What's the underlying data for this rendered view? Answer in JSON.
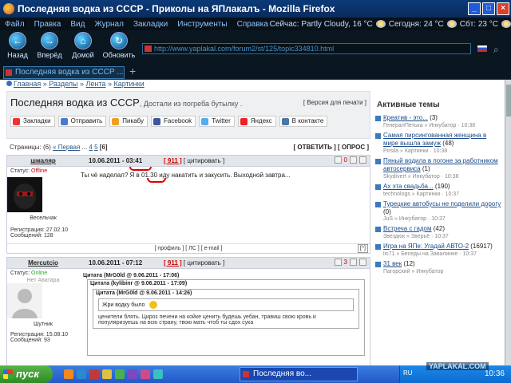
{
  "window": {
    "title": "Последняя водка из СССР - Приколы на ЯПлакалъ - Mozilla Firefox"
  },
  "menu": {
    "items": [
      "Файл",
      "Правка",
      "Вид",
      "Журнал",
      "Закладки",
      "Инструменты",
      "Справка"
    ],
    "weather_now": "Сейчас: Partly Cloudy, 16 °C",
    "weather_today": "Сегодня: 24 °C",
    "weather_sat": "Сбт: 23 °C"
  },
  "nav": {
    "back": "Назад",
    "forward": "Вперёд",
    "home": "Домой",
    "refresh": "Обновить",
    "url": "http://www.yaplakal.com/forum2/st/125/topic334810.html"
  },
  "tab": {
    "label": "Последняя водка из СССР ...",
    "new_tab": "+"
  },
  "breadcrumbs": [
    "Главная",
    "Разделы",
    "Лента",
    "Картинки"
  ],
  "topic": {
    "title": "Последняя водка из СССР",
    "subtitle": ", Достали из погреба бутылку .",
    "print_version": "[ Версия для печати ]"
  },
  "share": [
    {
      "label": "Закладки",
      "color": "#e33"
    },
    {
      "label": "Отправить",
      "color": "#4a7ad0"
    },
    {
      "label": "Пикабу",
      "color": "#f0a020"
    },
    {
      "label": "Facebook",
      "color": "#3b5998"
    },
    {
      "label": "Twitter",
      "color": "#55acee"
    },
    {
      "label": "Яндекс",
      "color": "#e22"
    },
    {
      "label": "В контакте",
      "color": "#4a76a8"
    }
  ],
  "pages": {
    "prefix": "Страницы: (6)",
    "first": "« Первая",
    "dots": "...",
    "p4": "4",
    "p5": "5",
    "current": "[6]",
    "actions": "[ ОТВЕТИТЬ ] [ ОПРОС ]"
  },
  "posts": [
    {
      "author": "шмаляр",
      "date": "10.06.2011 - 03:41",
      "num_label": "[ 911 ]",
      "quote_label": "[ цитировать ]",
      "status_label": "Статус:",
      "status": "Offline",
      "rank": "Весельчак",
      "reg": "Регистрация: 27.02.10",
      "msgs": "Сообщений: 128",
      "rating": "0",
      "text": "Ты чё наделал? Я в 01.30 иду накатить и закусить. Выходной завтра...",
      "footer": "[ профиль ]  [ ЛС ]  [ e-mail ]",
      "up": "[^]"
    },
    {
      "author": "Mercutcio",
      "date": "10.06.2011 - 07:12",
      "num_label": "[ 911 ]",
      "quote_label": "[ цитировать ]",
      "status_label": "Статус:",
      "status": "Online",
      "avatar_text": "Нет Аватара",
      "rank": "Шутник",
      "reg": "Регистрация: 15.08.10",
      "msgs": "Сообщений: 93",
      "rating": "3",
      "quote1": "Цитата (MrG0ld @ 9.06.2011 - 17:06)",
      "quote2": "Цитата (kylibinr @ 9.06.2011 - 17:09)",
      "quote3": "Цитата (MrG0ld @ 9.06.2011 - 14:26)",
      "q3_text": "Жри водку было",
      "q2_text": "ценители блять. Цироз печени на койке ценить будешь уебан, травиш свою кровь и популяризуешь на всю страну, твою мать чтоб ты сдох сука"
    }
  ],
  "sidebar": {
    "title": "Активные темы",
    "items": [
      {
        "title": "Креатив - это...",
        "count": "(3)",
        "user": "ГенералПетька",
        "section": "Инкубатор",
        "time": "10:38"
      },
      {
        "title": "Самая пирсингованная женщина в мире вышла замуж",
        "count": "(48)",
        "user": "Pirsila",
        "section": "Картинки",
        "time": "10:38"
      },
      {
        "title": "Пяный водила в погоне за работником автосервиса",
        "count": "(1)",
        "user": "Skydivert",
        "section": "Инкубатор",
        "time": "10:38"
      },
      {
        "title": "Ах эта свадьба...",
        "count": "(190)",
        "user": "technologs",
        "section": "Картинки",
        "time": "10:37"
      },
      {
        "title": "Турецкие автобусы не поделили дорогу",
        "count": "(0)",
        "user": "JuS",
        "section": "Инкубатор",
        "time": "10:37"
      },
      {
        "title": "Встреча с гадом",
        "count": "(42)",
        "user": "Звездюк",
        "section": "Зверьё",
        "time": "10:37"
      },
      {
        "title": "Игра на ЯПе: Угадай АВТО-2",
        "count": "(16917)",
        "user": "lis71",
        "section": "Беседы на Завалинке",
        "time": "10:37"
      },
      {
        "title": "31 век",
        "count": "(12)",
        "user": "Пагорский",
        "section": "Инкубатор",
        "time": ""
      }
    ]
  },
  "taskbar": {
    "start": "пуск",
    "task": "Последняя во...",
    "lang": "RU",
    "clock": "10:36"
  },
  "watermark": "YAPLAKAL.COM"
}
